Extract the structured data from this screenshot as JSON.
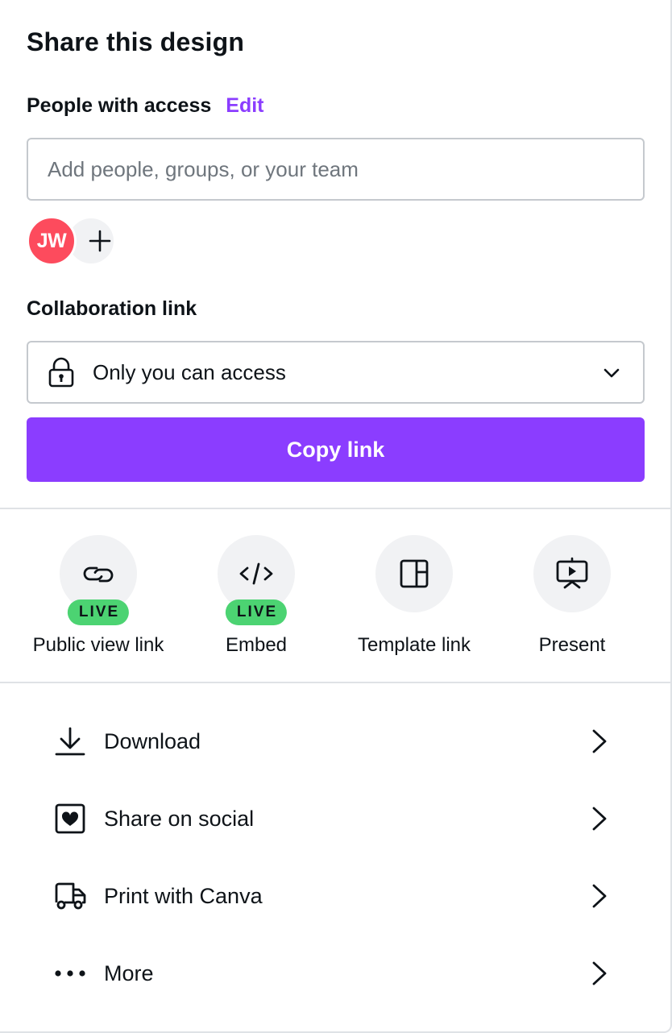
{
  "panel": {
    "title": "Share this design"
  },
  "people": {
    "label": "People with access",
    "edit_label": "Edit",
    "input_placeholder": "Add people, groups, or your team",
    "input_value": "",
    "avatars": [
      {
        "initials": "JW",
        "color": "#fd4b5d"
      }
    ],
    "add_icon": "plus-icon"
  },
  "collaboration": {
    "label": "Collaboration link",
    "access_icon": "lock-icon",
    "access_value": "Only you can access",
    "dropdown_icon": "chevron-down-icon",
    "copy_button": "Copy link"
  },
  "quick_actions": [
    {
      "label": "Public view link",
      "icon": "link-icon",
      "badge": "LIVE"
    },
    {
      "label": "Embed",
      "icon": "code-icon",
      "badge": "LIVE"
    },
    {
      "label": "Template link",
      "icon": "template-icon",
      "badge": null
    },
    {
      "label": "Present",
      "icon": "presentation-icon",
      "badge": null
    }
  ],
  "menu": [
    {
      "label": "Download",
      "icon": "download-icon"
    },
    {
      "label": "Share on social",
      "icon": "social-heart-icon"
    },
    {
      "label": "Print with Canva",
      "icon": "truck-icon"
    },
    {
      "label": "More",
      "icon": "more-dots-icon"
    }
  ],
  "colors": {
    "accent": "#8b3dff",
    "live_badge": "#4cd372",
    "avatar": "#fd4b5d",
    "icon_circle": "#f1f2f4",
    "border": "#c5c9ce",
    "divider": "#dfe2e6",
    "text": "#0e1318"
  }
}
